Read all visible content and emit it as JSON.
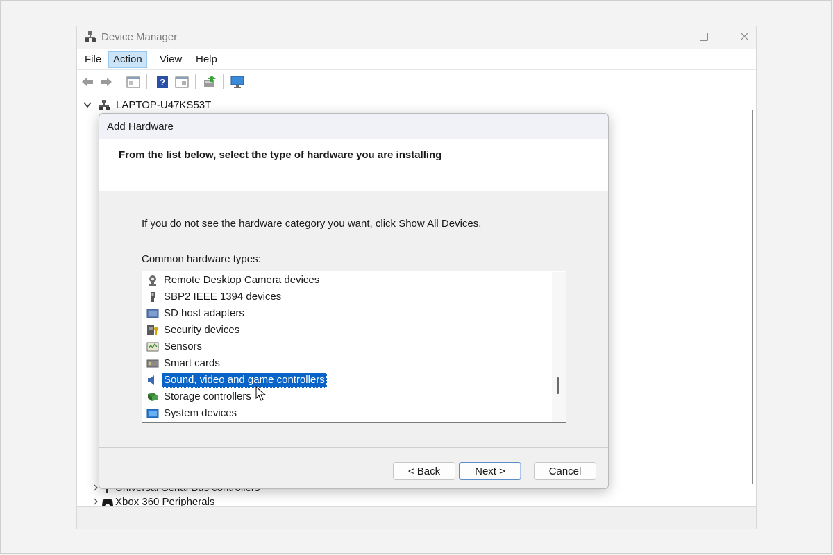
{
  "window": {
    "title": "Device Manager",
    "minimize_glyph": "—",
    "maximize_glyph": "☐",
    "close_glyph": "✕"
  },
  "menu": [
    {
      "label": "File"
    },
    {
      "label": "Action",
      "active": true
    },
    {
      "label": "View"
    },
    {
      "label": "Help"
    }
  ],
  "toolbar": {
    "icons": [
      "back-icon",
      "forward-icon",
      "properties-icon",
      "help-icon",
      "show-hide-icon",
      "update-driver-icon",
      "monitor-icon"
    ]
  },
  "tree": {
    "root_label": "LAPTOP-U47KS53T",
    "partial_items": [
      {
        "label": "Universal Serial Bus controllers"
      },
      {
        "label": "Xbox 360 Peripherals"
      }
    ]
  },
  "dialog": {
    "title": "Add Hardware",
    "heading": "From the list below, select the type of hardware you are installing",
    "hint": "If you do not see the hardware category you want, click Show All Devices.",
    "list_label": "Common hardware types:",
    "items": [
      {
        "label": "Remote Desktop Camera devices",
        "icon": "camera-icon"
      },
      {
        "label": "SBP2 IEEE 1394 devices",
        "icon": "ieee1394-icon"
      },
      {
        "label": "SD host adapters",
        "icon": "sd-adapter-icon"
      },
      {
        "label": "Security devices",
        "icon": "security-device-icon"
      },
      {
        "label": "Sensors",
        "icon": "sensor-icon"
      },
      {
        "label": "Smart cards",
        "icon": "smart-card-icon"
      },
      {
        "label": "Sound, video and game controllers",
        "icon": "speaker-icon",
        "selected": true
      },
      {
        "label": "Storage controllers",
        "icon": "storage-controller-icon"
      },
      {
        "label": "System devices",
        "icon": "system-devices-icon"
      }
    ],
    "buttons": {
      "back": "< Back",
      "next": "Next >",
      "cancel": "Cancel"
    }
  },
  "colors": {
    "selection": "#0a64c8",
    "menu_active": "#cce4f7"
  }
}
